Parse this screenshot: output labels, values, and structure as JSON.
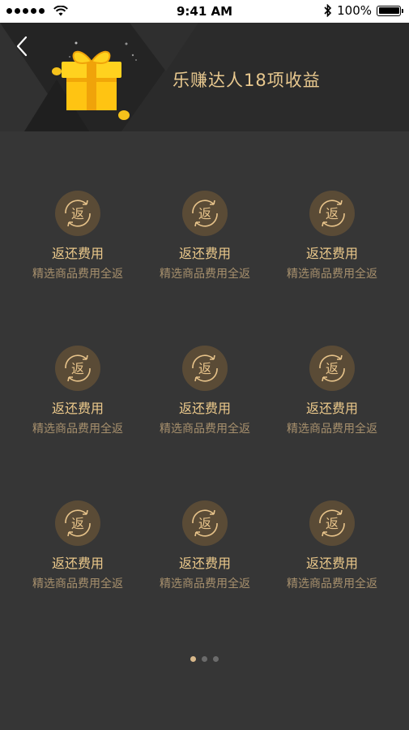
{
  "status_bar": {
    "time": "9:41 AM",
    "battery": "100%"
  },
  "header": {
    "title": "乐赚达人18项收益"
  },
  "benefit_icon_char": "返",
  "benefits": [
    {
      "title": "返还费用",
      "desc": "精选商品费用全返"
    },
    {
      "title": "返还费用",
      "desc": "精选商品费用全返"
    },
    {
      "title": "返还费用",
      "desc": "精选商品费用全返"
    },
    {
      "title": "返还费用",
      "desc": "精选商品费用全返"
    },
    {
      "title": "返还费用",
      "desc": "精选商品费用全返"
    },
    {
      "title": "返还费用",
      "desc": "精选商品费用全返"
    },
    {
      "title": "返还费用",
      "desc": "精选商品费用全返"
    },
    {
      "title": "返还费用",
      "desc": "精选商品费用全返"
    },
    {
      "title": "返还费用",
      "desc": "精选商品费用全返"
    }
  ],
  "pager": {
    "count": 3,
    "active_index": 0
  },
  "colors": {
    "accent_gold": "#ecc98b",
    "desc_gold": "#a7906d",
    "background": "#363636",
    "header_bg": "#2b2b2b"
  }
}
